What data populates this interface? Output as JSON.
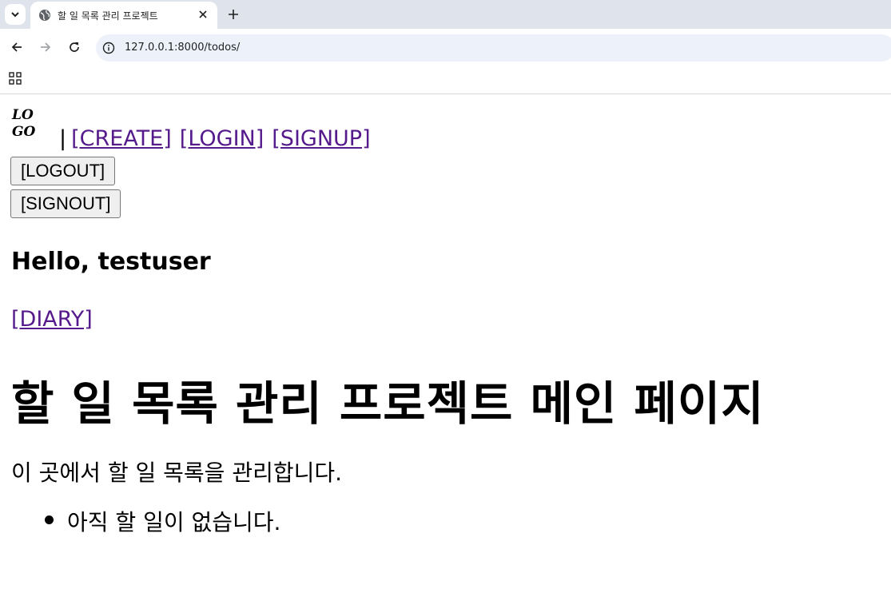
{
  "browser": {
    "tab_title": "할 일 목록 관리 프로젝트",
    "url": "127.0.0.1:8000/todos/",
    "icons": {
      "tab_search": "chevron-down-icon",
      "favicon": "globe-icon",
      "close": "close-icon",
      "new_tab": "plus-icon",
      "back": "arrow-left-icon",
      "forward": "arrow-right-icon",
      "reload": "reload-icon",
      "site_info": "info-icon",
      "apps": "apps-grid-icon"
    }
  },
  "header": {
    "logo_line1": "LO",
    "logo_line2": "GO",
    "separator": "|",
    "links": {
      "create": "[CREATE]",
      "login": "[LOGIN]",
      "signup": "[SIGNUP]"
    },
    "buttons": {
      "logout": "[LOGOUT]",
      "signout": "[SIGNOUT]"
    }
  },
  "main": {
    "greeting": "Hello, testuser",
    "diary_link": "[DIARY]",
    "title": "할 일 목록 관리 프로젝트 메인 페이지",
    "description": "이 곳에서 할 일 목록을 관리합니다.",
    "todos": [
      "아직 할 일이 없습니다."
    ]
  },
  "colors": {
    "visited_link": "#551a8b",
    "tabstrip_bg": "#dfe3eb",
    "omnibox_bg": "#edf2fa"
  }
}
